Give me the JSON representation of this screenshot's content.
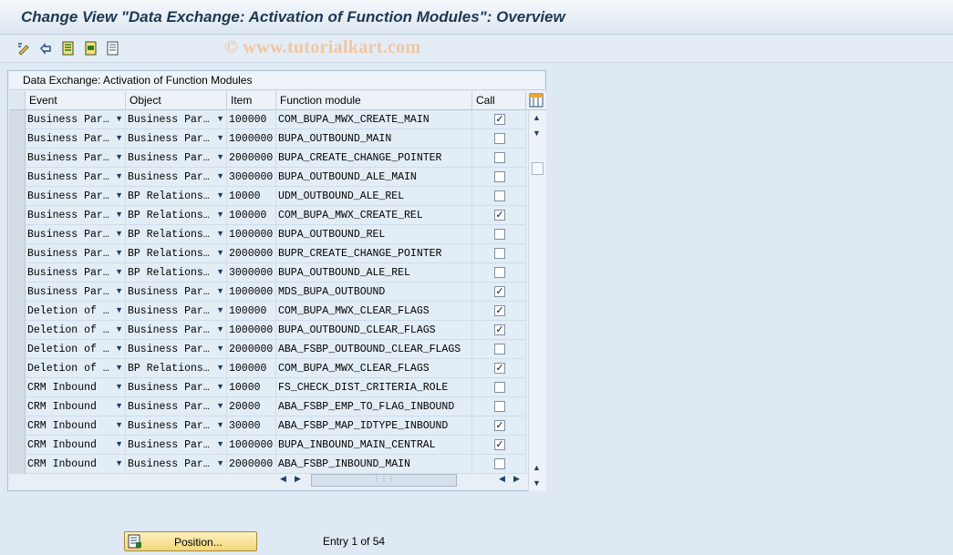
{
  "window": {
    "title": "Change View \"Data Exchange: Activation of Function Modules\": Overview",
    "watermark": "© www.tutorialkart.com"
  },
  "toolbar": {
    "icons": [
      "change-display-icon",
      "undo-icon",
      "select-all-icon",
      "select-block-icon",
      "deselect-all-icon"
    ]
  },
  "table": {
    "title": "Data Exchange: Activation of Function Modules",
    "columns": [
      "Event",
      "Object",
      "Item",
      "Function module",
      "Call"
    ],
    "rows": [
      {
        "event": "Business Par…",
        "object": "Business Par…",
        "item": "100000",
        "fm": "COM_BUPA_MWX_CREATE_MAIN",
        "call": true
      },
      {
        "event": "Business Par…",
        "object": "Business Par…",
        "item": "1000000",
        "fm": "BUPA_OUTBOUND_MAIN",
        "call": false
      },
      {
        "event": "Business Par…",
        "object": "Business Par…",
        "item": "2000000",
        "fm": "BUPA_CREATE_CHANGE_POINTER",
        "call": false
      },
      {
        "event": "Business Par…",
        "object": "Business Par…",
        "item": "3000000",
        "fm": "BUPA_OUTBOUND_ALE_MAIN",
        "call": false
      },
      {
        "event": "Business Par…",
        "object": "BP Relations…",
        "item": "10000",
        "fm": "UDM_OUTBOUND_ALE_REL",
        "call": false
      },
      {
        "event": "Business Par…",
        "object": "BP Relations…",
        "item": "100000",
        "fm": "COM_BUPA_MWX_CREATE_REL",
        "call": true
      },
      {
        "event": "Business Par…",
        "object": "BP Relations…",
        "item": "1000000",
        "fm": "BUPA_OUTBOUND_REL",
        "call": false
      },
      {
        "event": "Business Par…",
        "object": "BP Relations…",
        "item": "2000000",
        "fm": "BUPR_CREATE_CHANGE_POINTER",
        "call": false
      },
      {
        "event": "Business Par…",
        "object": "BP Relations…",
        "item": "3000000",
        "fm": "BUPA_OUTBOUND_ALE_REL",
        "call": false
      },
      {
        "event": "Business Par…",
        "object": "Business Par…",
        "item": "1000000",
        "fm": "MDS_BUPA_OUTBOUND",
        "call": true
      },
      {
        "event": "Deletion of …",
        "object": "Business Par…",
        "item": "100000",
        "fm": "COM_BUPA_MWX_CLEAR_FLAGS",
        "call": true
      },
      {
        "event": "Deletion of …",
        "object": "Business Par…",
        "item": "1000000",
        "fm": "BUPA_OUTBOUND_CLEAR_FLAGS",
        "call": true
      },
      {
        "event": "Deletion of …",
        "object": "Business Par…",
        "item": "2000000",
        "fm": "ABA_FSBP_OUTBOUND_CLEAR_FLAGS",
        "call": false
      },
      {
        "event": "Deletion of …",
        "object": "BP Relations…",
        "item": "100000",
        "fm": "COM_BUPA_MWX_CLEAR_FLAGS",
        "call": true
      },
      {
        "event": "CRM Inbound",
        "object": "Business Par…",
        "item": "10000",
        "fm": "FS_CHECK_DIST_CRITERIA_ROLE",
        "call": false
      },
      {
        "event": "CRM Inbound",
        "object": "Business Par…",
        "item": "20000",
        "fm": "ABA_FSBP_EMP_TO_FLAG_INBOUND",
        "call": false
      },
      {
        "event": "CRM Inbound",
        "object": "Business Par…",
        "item": "30000",
        "fm": "ABA_FSBP_MAP_IDTYPE_INBOUND",
        "call": true
      },
      {
        "event": "CRM Inbound",
        "object": "Business Par…",
        "item": "1000000",
        "fm": "BUPA_INBOUND_MAIN_CENTRAL",
        "call": true
      },
      {
        "event": "CRM Inbound",
        "object": "Business Par…",
        "item": "2000000",
        "fm": "ABA_FSBP_INBOUND_MAIN",
        "call": false
      }
    ]
  },
  "footer": {
    "position_label": "Position...",
    "entry_text": "Entry 1 of 54"
  }
}
